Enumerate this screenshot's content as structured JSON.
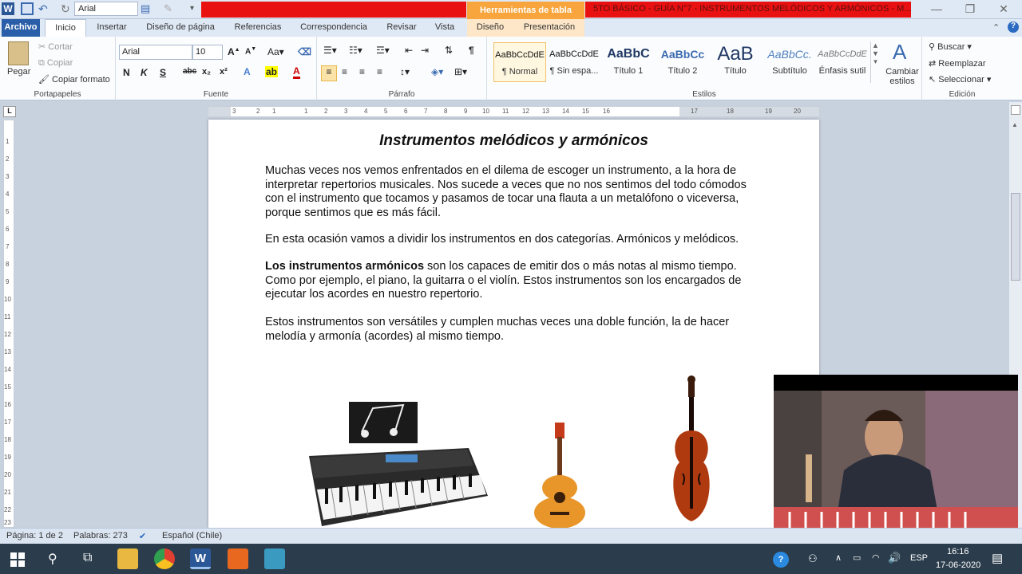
{
  "qat": {
    "font_box": "Arial"
  },
  "titlebar": {
    "contextual_tab_group": "Herramientas de tabla",
    "document_title": "5TO BÁSICO - GUÍA N°7 - INSTRUMENTOS MELÓDICOS Y ARMÓNICOS  -  M..."
  },
  "tabs": [
    "Archivo",
    "Inicio",
    "Insertar",
    "Diseño de página",
    "Referencias",
    "Correspondencia",
    "Revisar",
    "Vista",
    "Diseño",
    "Presentación"
  ],
  "ribbon": {
    "clipboard": {
      "paste": "Pegar",
      "cut": "Cortar",
      "copy": "Copiar",
      "format_painter": "Copiar formato",
      "label": "Portapapeles"
    },
    "font": {
      "name": "Arial",
      "size": "10",
      "label": "Fuente"
    },
    "paragraph": {
      "label": "Párrafo"
    },
    "styles": {
      "label": "Estilos",
      "items": [
        {
          "preview": "AaBbCcDdE",
          "name": "¶ Normal"
        },
        {
          "preview": "AaBbCcDdE",
          "name": "¶ Sin espa..."
        },
        {
          "preview": "AaBbC",
          "name": "Título 1"
        },
        {
          "preview": "AaBbCc",
          "name": "Título 2"
        },
        {
          "preview": "AaB",
          "name": "Título"
        },
        {
          "preview": "AaBbCc.",
          "name": "Subtítulo"
        },
        {
          "preview": "AaBbCcDdE",
          "name": "Énfasis sutil"
        }
      ],
      "change_styles": "Cambiar estilos"
    },
    "editing": {
      "find": "Buscar",
      "replace": "Reemplazar",
      "select": "Seleccionar",
      "label": "Edición"
    }
  },
  "ruler": {
    "h_numbers": [
      "3",
      "2",
      "1",
      "1",
      "2",
      "3",
      "4",
      "5",
      "6",
      "7",
      "8",
      "9",
      "10",
      "11",
      "12",
      "13",
      "14",
      "15",
      "16",
      "17",
      "18",
      "19",
      "20"
    ],
    "v_numbers": [
      "1",
      "2",
      "3",
      "4",
      "5",
      "6",
      "7",
      "8",
      "9",
      "10",
      "11",
      "12",
      "13",
      "14",
      "15",
      "16",
      "17",
      "18",
      "19",
      "20",
      "21",
      "22",
      "23"
    ]
  },
  "document": {
    "heading": "Instrumentos melódicos y armónicos",
    "p1": "Muchas veces nos vemos enfrentados en el dilema de escoger un instrumento, a la hora de interpretar repertorios musicales. Nos sucede a veces que no nos sentimos del todo cómodos con el instrumento que tocamos y pasamos de tocar una flauta a un metalófono o viceversa, porque sentimos que es más fácil.",
    "p2": "En esta ocasión vamos a dividir los instrumentos en dos categorías.  Armónicos y melódicos.",
    "p3_bold": "Los instrumentos armónicos",
    "p3_rest": " son los capaces de emitir dos o más notas al mismo tiempo. Como por ejemplo, el piano, la guitarra o el violín. Estos instrumentos son los encargados de ejecutar los acordes en nuestro repertorio.",
    "p4": "Estos instrumentos son versátiles y cumplen muchas veces una doble función, la de hacer melodía y armonía (acordes) al mismo tiempo."
  },
  "status": {
    "page": "Página: 1 de 2",
    "words": "Palabras: 273",
    "language": "Español (Chile)"
  },
  "taskbar": {
    "lang": "ESP",
    "time": "16:16",
    "date": "17-06-2020"
  }
}
